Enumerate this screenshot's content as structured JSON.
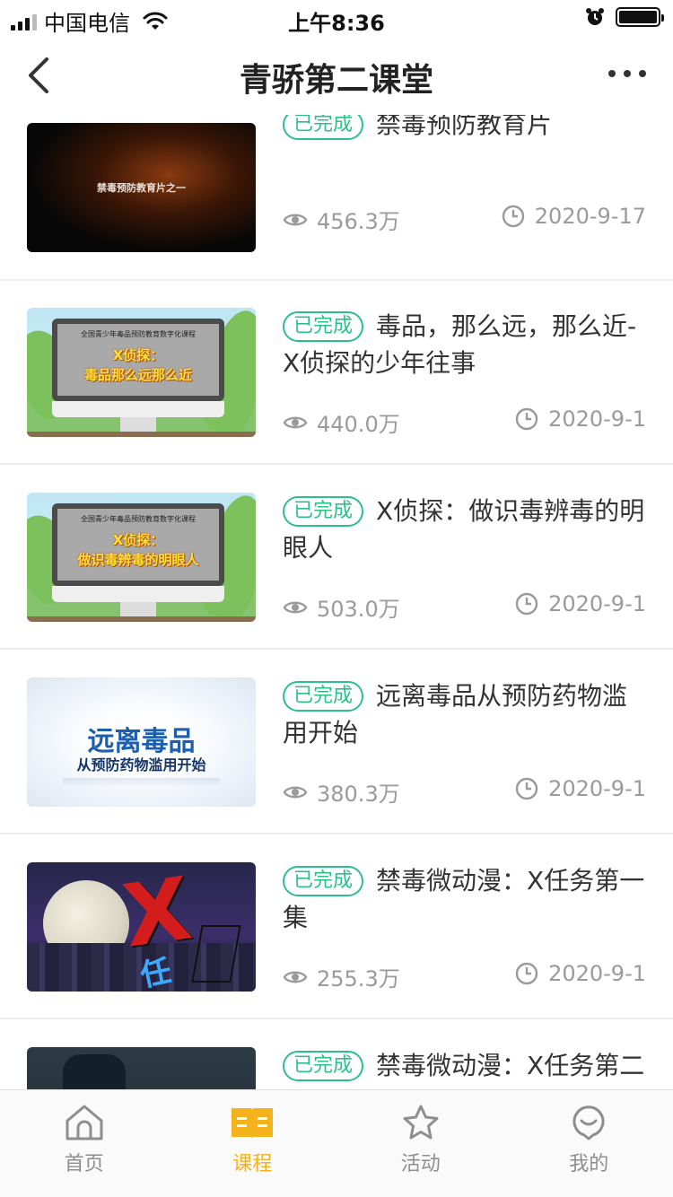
{
  "status_bar": {
    "carrier": "中国电信",
    "time": "上午8:36"
  },
  "nav": {
    "title": "青骄第二课堂"
  },
  "colors": {
    "accent_green": "#2dbf8a",
    "active_tab": "#f4b21d"
  },
  "courses": [
    {
      "badge": "已完成",
      "title": "禁毒预防教育片",
      "views": "456.3万",
      "date": "2020-9-17",
      "thumb_text": "禁毒预防教育片之一"
    },
    {
      "badge": "已完成",
      "title": "毒品，那么远，那么近-X侦探的少年往事",
      "views": "440.0万",
      "date": "2020-9-1",
      "thumb_caption": "全国青少年毒品预防教育数字化课程",
      "thumb_line1": "X侦探：",
      "thumb_line2": "毒品那么远那么近"
    },
    {
      "badge": "已完成",
      "title": "X侦探：做识毒辨毒的明眼人",
      "views": "503.0万",
      "date": "2020-9-1",
      "thumb_caption": "全国青少年毒品预防教育数字化课程",
      "thumb_line1": "X侦探：",
      "thumb_line2": "做识毒辨毒的明眼人"
    },
    {
      "badge": "已完成",
      "title": "远离毒品从预防药物滥用开始",
      "views": "380.3万",
      "date": "2020-9-1",
      "thumb_line1": "远离毒品",
      "thumb_line2": "从预防药物滥用开始"
    },
    {
      "badge": "已完成",
      "title": "禁毒微动漫：X任务第一集",
      "views": "255.3万",
      "date": "2020-9-1"
    },
    {
      "badge": "已完成",
      "title": "禁毒微动漫：X任务第二",
      "views": "",
      "date": ""
    }
  ],
  "tabs": [
    {
      "label": "首页",
      "icon": "home-icon",
      "active": false
    },
    {
      "label": "课程",
      "icon": "book-icon",
      "active": true
    },
    {
      "label": "活动",
      "icon": "star-icon",
      "active": false
    },
    {
      "label": "我的",
      "icon": "smile-icon",
      "active": false
    }
  ]
}
